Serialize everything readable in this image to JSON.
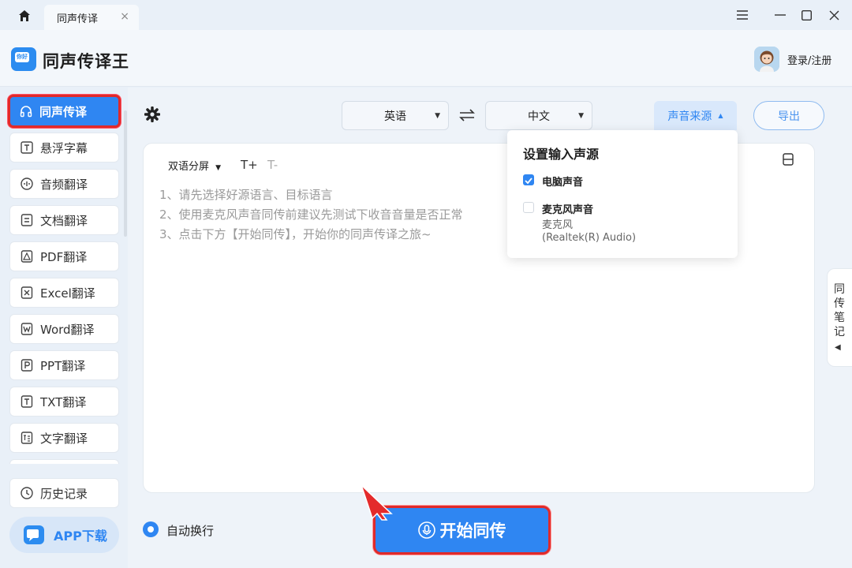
{
  "titlebar": {
    "tab_label": "同声传译",
    "tab_close": "×"
  },
  "header": {
    "app_title": "同声传译王",
    "login_label": "登录/注册",
    "logo_text": "你好 Hi"
  },
  "sidebar": {
    "items": [
      {
        "label": "同声传译",
        "icon": "headphones-icon",
        "active": true
      },
      {
        "label": "悬浮字幕",
        "icon": "subtitle-icon"
      },
      {
        "label": "音频翻译",
        "icon": "audio-icon"
      },
      {
        "label": "文档翻译",
        "icon": "document-icon"
      },
      {
        "label": "PDF翻译",
        "icon": "pdf-icon"
      },
      {
        "label": "Excel翻译",
        "icon": "excel-icon"
      },
      {
        "label": "Word翻译",
        "icon": "word-icon"
      },
      {
        "label": "PPT翻译",
        "icon": "ppt-icon"
      },
      {
        "label": "TXT翻译",
        "icon": "txt-icon"
      },
      {
        "label": "文字翻译",
        "icon": "text-translate-icon"
      }
    ],
    "history_label": "历史记录",
    "app_download": "APP下载"
  },
  "toolbar": {
    "source_lang": "英语",
    "target_lang": "中文",
    "sound_source": "声音来源",
    "export": "导出"
  },
  "panel": {
    "mode": "双语分屏",
    "font_up": "T+",
    "font_down": "T-",
    "hints": [
      "1、请先选择好源语言、目标语言",
      "2、使用麦克风声音同传前建议先测试下收音音量是否正常",
      "3、点击下方【开始同传】，开始你的同声传译之旅~"
    ]
  },
  "dropdown": {
    "title": "设置输入声源",
    "options": [
      {
        "label": "电脑声音",
        "checked": true
      },
      {
        "label": "麦克风声音",
        "checked": false,
        "device": "麦克风",
        "device_detail": "(Realtek(R) Audio)"
      }
    ]
  },
  "side_notes": {
    "label": "同传笔记"
  },
  "bottom": {
    "auto_wrap": "自动换行",
    "start": "开始同传"
  },
  "colors": {
    "accent": "#2f86f2",
    "highlight": "#e02a2a"
  }
}
